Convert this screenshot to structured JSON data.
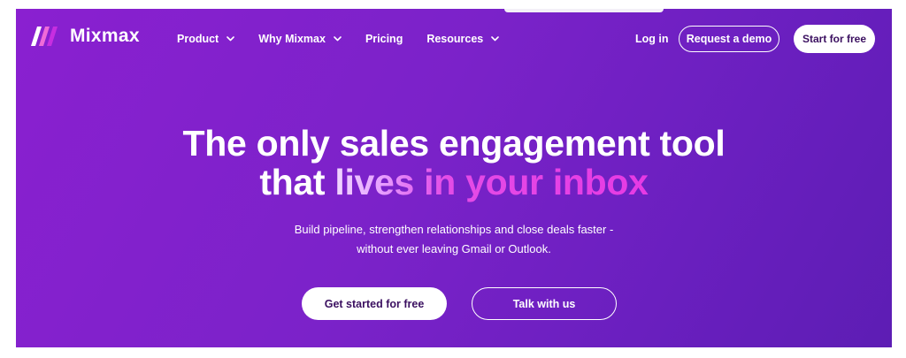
{
  "brand": {
    "name": "Mixmax",
    "logo_icon": "mixmax-logo-icon",
    "logo_colors": [
      "#ffffff",
      "#f06bd8",
      "#c72ee0"
    ]
  },
  "nav": {
    "items": [
      {
        "label": "Product",
        "has_dropdown": true,
        "icon": "chevron-down-icon"
      },
      {
        "label": "Why Mixmax",
        "has_dropdown": true,
        "icon": "chevron-down-icon"
      },
      {
        "label": "Pricing",
        "has_dropdown": false
      },
      {
        "label": "Resources",
        "has_dropdown": true,
        "icon": "chevron-down-icon"
      }
    ],
    "login_label": "Log in",
    "demo_label": "Request a demo",
    "start_label": "Start for free"
  },
  "hero": {
    "headline_line1": "The only sales engagement tool",
    "headline_line2_plain": "that ",
    "headline_line2_highlight": "lives in your inbox",
    "subtext_line1": "Build pipeline, strengthen relationships and close deals faster -",
    "subtext_line2": "without ever leaving Gmail or Outlook.",
    "cta_primary_label": "Get started for free",
    "cta_secondary_label": "Talk with us"
  },
  "colors": {
    "background_start": "#8a20d0",
    "background_end": "#5d1db4",
    "highlight_text": "#e63ae4",
    "button_text_dark": "#3b1060"
  }
}
